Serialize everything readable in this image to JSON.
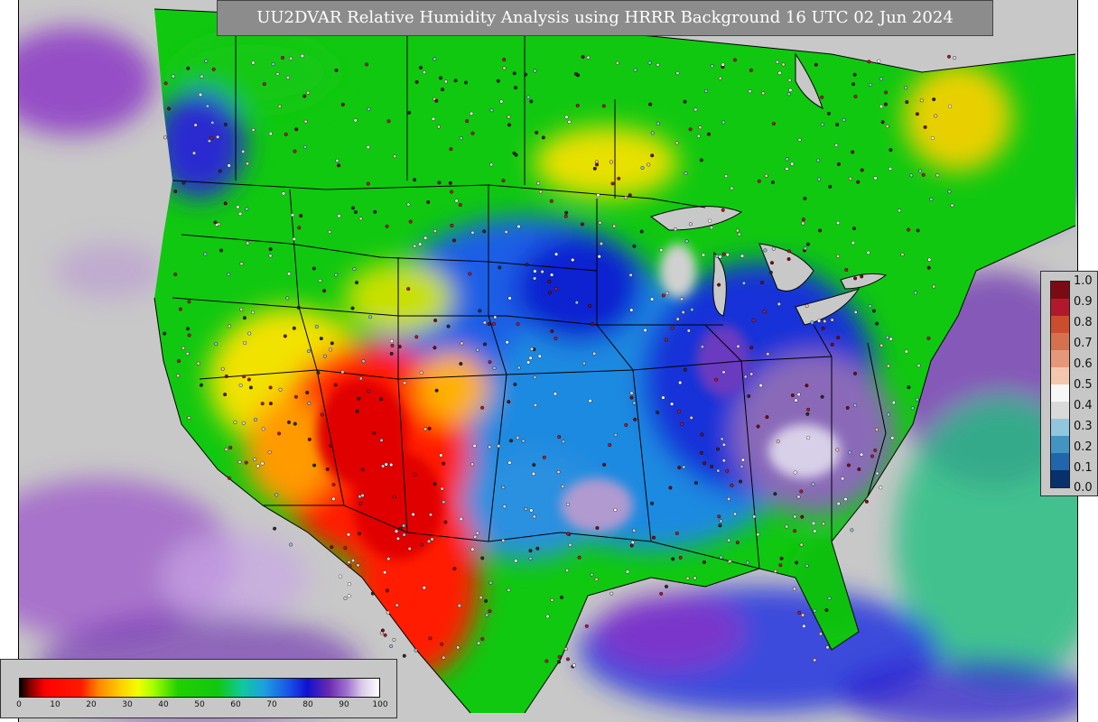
{
  "title": "UU2DVAR Relative Humidity Analysis using HRRR Background 16 UTC 02 Jun 2024",
  "obs_legend": {
    "ticks": [
      "1.0",
      "0.9",
      "0.8",
      "0.7",
      "0.6",
      "0.5",
      "0.4",
      "0.3",
      "0.2",
      "0.1",
      "0.0"
    ],
    "colors_top_to_bottom": [
      "#7a0a14",
      "#b2182b",
      "#cc4c2e",
      "#d6714f",
      "#e5977a",
      "#f3c7ad",
      "#f7f7f7",
      "#d9d9d9",
      "#92c5de",
      "#4393c3",
      "#2166ac",
      "#08306b"
    ]
  },
  "field_legend": {
    "ticks": [
      "0",
      "10",
      "20",
      "30",
      "40",
      "50",
      "60",
      "70",
      "80",
      "90",
      "100"
    ]
  },
  "colors": {
    "ocean_gray": "#c8c8c8",
    "dry_red": "#ff1a00",
    "moist_blue": "#0a1ee6",
    "moist_green": "#10c810"
  }
}
